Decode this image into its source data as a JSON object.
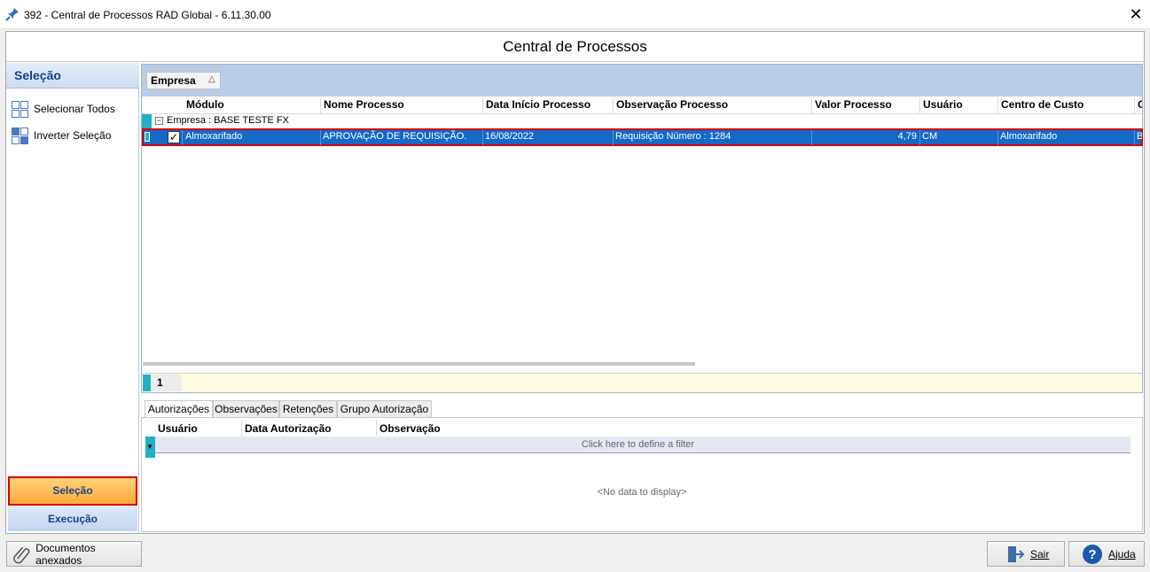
{
  "window": {
    "title": "392 - Central de Processos RAD Global - 6.11.30.00",
    "close": "✕"
  },
  "header": {
    "title": "Central de Processos"
  },
  "sidebar": {
    "title": "Seleção",
    "items": [
      {
        "label": "Selecionar Todos"
      },
      {
        "label": "Inverter Seleção"
      }
    ],
    "nav_buttons": [
      {
        "label": "Seleção",
        "active": true
      },
      {
        "label": "Execução",
        "active": false
      }
    ]
  },
  "grid": {
    "group_by": "Empresa",
    "columns": [
      "Módulo",
      "Nome Processo",
      "Data Início Processo",
      "Observação Processo",
      "Valor Processo",
      "Usuário",
      "Centro de Custo",
      "G"
    ],
    "group_label": "Empresa : BASE TESTE FX",
    "rows": [
      {
        "checked": true,
        "modulo": "Almoxarifado",
        "nome": "APROVAÇÃO DE REQUISIÇÃO.",
        "data": "16/08/2022",
        "obs": "Requisição Número : 1284",
        "valor": "4,79",
        "usuario": "CM",
        "centro": "Almoxarifado",
        "extra": "B"
      }
    ],
    "footer_count": "1"
  },
  "tabs": [
    {
      "label": "Autorizações"
    },
    {
      "label": "Observações"
    },
    {
      "label": "Retenções"
    },
    {
      "label": "Grupo Autorização"
    }
  ],
  "auth_grid": {
    "columns": [
      "Usuário",
      "Data Autorização",
      "Observação"
    ],
    "filter_hint": "Click here to define a filter",
    "empty_text": "<No data to display>"
  },
  "buttons": {
    "documents": "Documentos anexados",
    "exit": "Sair",
    "help": "Ajuda"
  },
  "colors": {
    "selection": "#1569c7",
    "highlight": "#d40000",
    "accent_teal": "#20b2c4",
    "nav_active": "#ffab3c"
  }
}
